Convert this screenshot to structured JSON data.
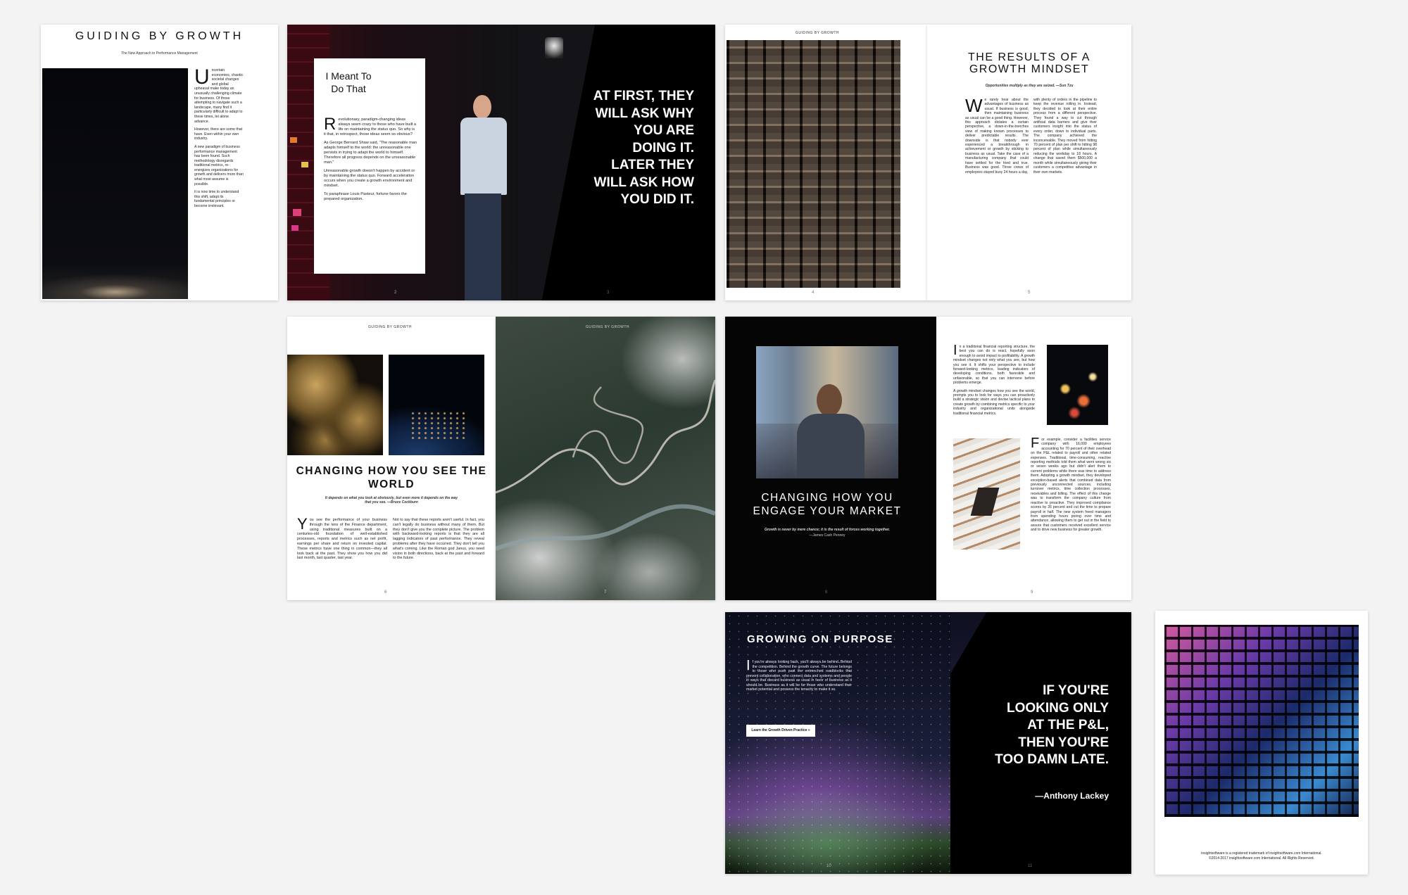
{
  "page1": {
    "title": "GUIDING BY GROWTH",
    "subtitle": "The New Approach to Performance Management",
    "dropcap": "U",
    "paragraphs": [
      "ncertain economies, chaotic societal changes and global upheaval make today an unusually challenging climate for business. Of those attempting to navigate such a landscape, many find it particularly difficult to adapt to these times, let alone advance.",
      "However, there are some that have. Even within your own industry.",
      "A new paradigm of business performance management has been found. Such methodology disregards traditional metrics, re-energizes organizations for growth and delivers more than what most assume is possible.",
      "It is now time to understand this shift, adapt its fundamental principles or become irrelevant."
    ]
  },
  "page2": {
    "card_title": "I Meant To Do That",
    "dropcap": "R",
    "paragraphs": [
      "evolutionary, paradigm-changing ideas always seem crazy to those who have built a life on maintaining the status quo. So why is it that, in retrospect, those ideas seem so obvious?",
      "As George Bernard Shaw said, \"The reasonable man adapts himself to the world: the unreasonable one persists in trying to adapt the world to himself. Therefore all progress depends on the unreasonable man.\"",
      "Unreasonable growth doesn't happen by accident or by maintaining the status quo. Forward acceleration occurs when you create a growth environment and mindset.",
      "To paraphrase Louis Pasteur, fortune favors the prepared organization."
    ],
    "page_number": "2"
  },
  "page3": {
    "quote": "AT FIRST, THEY WILL ASK WHY YOU ARE DOING IT. LATER THEY WILL ASK HOW YOU DID IT.",
    "page_number": "3"
  },
  "page4": {
    "running_head": "GUIDING BY GROWTH",
    "page_number": "4"
  },
  "page5": {
    "title": "THE RESULTS OF A GROWTH MINDSET",
    "epigraph": "Opportunities multiply as they are seized. —Sun Tzu",
    "dropcap": "W",
    "col1": "e rarely hear about the advantages of business as usual. If business is good, then maintaining business as usual can be a good thing. However, this approach dictates a certain perspective, a down-in-the-trenches view of making known processes to deliver predictable results. The downside is that nobody ever experienced a breakthrough in achievement or growth by sticking to business as usual. Take the case of a manufacturing company that could have settled for the tried and true. Business was good. Three crews of employees stayed busy 24 hours a day,",
    "col2": "with plenty of orders in the pipeline to keep the revenue rolling in. Instead, they decided to look at their entire process from a different perspective. They found a way to cut through artificial data barriers and give their customers insight into the status of every order, down to individual parts. The company achieved the inconceivable. They moved from hitting 70 percent of plan per shift to hitting 98 percent of plan while simultaneously reducing the workday to 18 hours. A change that saved them $500,000 a month while simultaneously giving their customers a competitive advantage in their own markets.",
    "page_number": "5"
  },
  "page6": {
    "running_head": "GUIDING BY GROWTH",
    "title": "CHANGING HOW YOU SEE THE WORLD",
    "epigraph": "It depends on what you look at obviously, but even more it depends on the way that you see. —Bruce Cockburn",
    "dropcap": "Y",
    "col1": "ou see the performance of your business through the lens of the Finance department, using traditional measures built on a centuries-old foundation of well-established processes, reports and metrics such as net profit, earnings per share and return on invested capital. These metrics have one thing in common—they all look back at the past. They show you how you did last month, last quarter, last year.",
    "col2": "Not to say that these reports aren't useful. In fact, you can't legally do business without many of them. But they don't give you the complete picture. The problem with backward-looking reports is that they are all lagging indicators of past performance. They reveal problems after they have occurred. They don't tell you what's coming. Like the Roman god Janus, you need vision in both directions, back at the past and forward to the future.",
    "page_number": "6"
  },
  "page7": {
    "running_head": "GUIDING BY GROWTH",
    "page_number": "7"
  },
  "page8": {
    "title": "CHANGING HOW YOU ENGAGE YOUR MARKET",
    "quote": "Growth is never by mere chance; it is the result of forces working together.",
    "attribution": "—James Cash Penney",
    "page_number": "8"
  },
  "page9": {
    "dropcap1": "I",
    "text1": "n a traditional financial reporting structure, the best you can do is react, hopefully soon enough to avoid impact to profitability. A growth mindset changes not only what you see, but how you see it. It shifts your perspective to include forward-looking metrics, leading indicators of developing conditions, both favorable and unfavorable, so that you can intervene before problems emerge.",
    "text2": "A growth mindset changes how you see the world, prompts you to look for ways you can proactively build a strategic vision and devise tactical plans to create growth by combining metrics specific to your industry and organizational units alongside traditional financial metrics.",
    "dropcap2": "F",
    "text3": "or example, consider a facilities service company with 16,000 employees accounting for 70 percent of their overhead on the P&L related to payroll and other related expenses. Traditional, time-consuming, reactive reporting methods told them what went wrong six or seven weeks ago but didn't alert them to current problems while there was time to address them. Adopting a growth mindset, they developed exception-based alerts that combined data from previously unconnected sources, including turnover metrics, time collection processes, receivables and billing. The effect of this change was to transform the company culture from reactive to proactive. They improved compliance scores by 26 percent and cut the time to prepare payroll in half. The new system freed managers from spending hours poring over time and attendance, allowing them to get out in the field to assure that customers received excellent service and to drive new business for greater growth.",
    "page_number": "9"
  },
  "page10": {
    "title": "GROWING ON PURPOSE",
    "dropcap": "I",
    "text": "f you're always looking back, you'll always be behind. Behind the competition. Behind the growth curve. The future belongs to those who push past the entrenched roadblocks that prevent collaboration, who connect data and systems and people in ways that discard business as usual in favor of business as it should be. Business as it will be for those who understand their market potential and possess the tenacity to make it so.",
    "button_label": "Learn the Growth Driven Practice »",
    "page_number": "10"
  },
  "page11": {
    "quote": "IF YOU'RE LOOKING ONLY AT THE P&L, THEN YOU'RE TOO DAMN LATE.",
    "attribution": "—Anthony Lackey",
    "page_number": "11"
  },
  "page12": {
    "legal1": "insightsoftware is a registered trademark of insightsoftware.com International.",
    "legal2": "©2014-2017 insightsoftware.com International. All Rights Reserved."
  }
}
